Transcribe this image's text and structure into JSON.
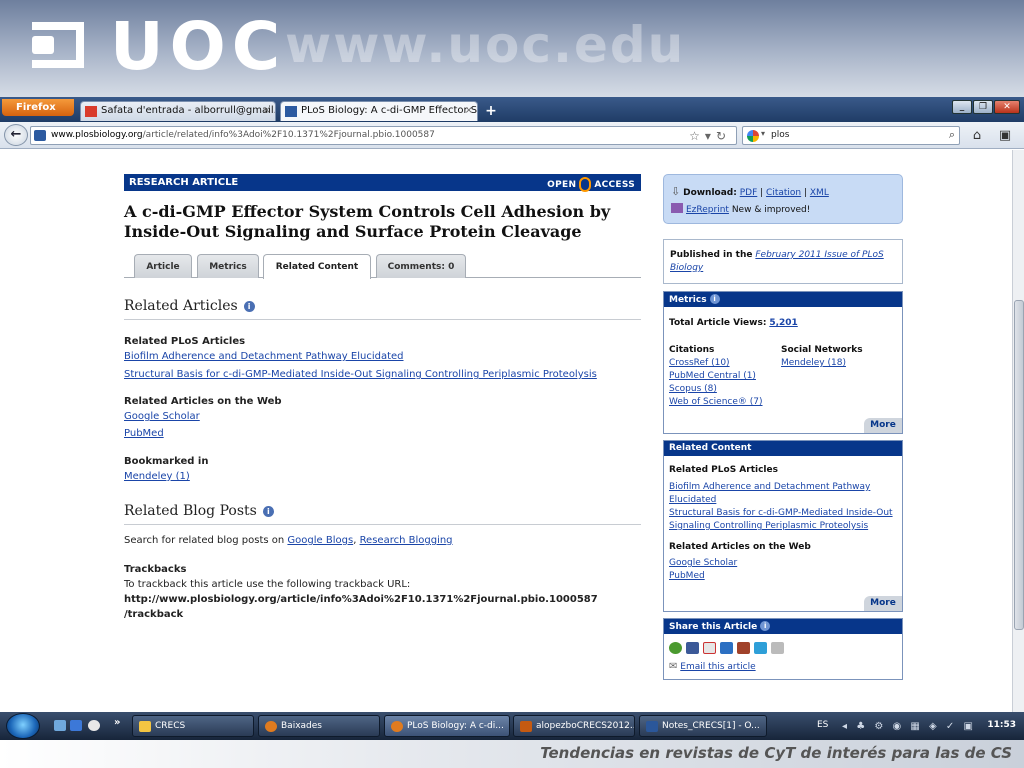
{
  "banner": {
    "logo_text": "UOC",
    "url_text": "www.uoc.edu"
  },
  "browser": {
    "menu_button": "Firefox",
    "tabs": [
      {
        "label": "Safata d'entrada - alborrull@gmail.co...",
        "active": false
      },
      {
        "label": "PLoS Biology: A c-di-GMP Effector Sy...",
        "active": true
      }
    ],
    "new_tab": "+",
    "url_host": "www.plosbiology.org",
    "url_path": "/article/related/info%3Adoi%2F10.1371%2Fjournal.pbio.1000587",
    "search_value": "plos"
  },
  "article": {
    "banner_label": "RESEARCH ARTICLE",
    "open_label": "OPEN",
    "access_label": "ACCESS",
    "title": "A c-di-GMP Effector System Controls Cell Adhesion by Inside-Out Signaling and Surface Protein Cleavage",
    "tabs": [
      "Article",
      "Metrics",
      "Related Content",
      "Comments: 0"
    ],
    "related_articles_heading": "Related Articles",
    "related_plos_heading": "Related PLoS Articles",
    "related_plos_links": [
      "Biofilm Adherence and Detachment Pathway Elucidated",
      "Structural Basis for c-di-GMP-Mediated Inside-Out Signaling Controlling Periplasmic Proteolysis"
    ],
    "related_web_heading": "Related Articles on the Web",
    "related_web_links": [
      "Google Scholar",
      "PubMed"
    ],
    "bookmarked_heading": "Bookmarked in",
    "bookmarked_links": [
      "Mendeley (1)"
    ],
    "blog_heading": "Related Blog Posts",
    "blog_text_prefix": "Search for related blog posts on",
    "blog_link1": "Google Blogs",
    "blog_sep": ",",
    "blog_link2": "Research Blogging",
    "trackbacks_heading": "Trackbacks",
    "trackbacks_text": "To trackback this article use the following trackback URL:",
    "trackback_url_line1": "http://www.plosbiology.org/article/info%3Adoi%2F10.1371%2Fjournal.pbio.1000587",
    "trackback_url_line2": "/trackback"
  },
  "sidebar": {
    "download_label": "Download:",
    "download_pdf": "PDF",
    "download_citation": "Citation",
    "download_xml": "XML",
    "ezreprint": "EzReprint",
    "ezreprint_note": "New & improved!",
    "published_prefix": "Published in the",
    "published_link": "February 2011 Issue of PLoS Biology",
    "metrics_heading": "Metrics",
    "total_views_label": "Total Article Views:",
    "total_views_value": "5,201",
    "citations_heading": "Citations",
    "citations_links": [
      "CrossRef (10)",
      "PubMed Central (1)",
      "Scopus (8)",
      "Web of Science® (7)"
    ],
    "social_heading": "Social Networks",
    "social_links": [
      "Mendeley (18)"
    ],
    "more_label": "More",
    "related_heading": "Related Content",
    "related_plos_heading": "Related PLoS Articles",
    "related_plos_links": [
      "Biofilm Adherence and Detachment Pathway Elucidated",
      "Structural Basis for c-di-GMP-Mediated Inside-Out Signaling Controlling Periplasmic Proteolysis"
    ],
    "related_web_heading": "Related Articles on the Web",
    "related_web_links": [
      "Google Scholar",
      "PubMed"
    ],
    "share_heading": "Share this Article",
    "email_link": "Email this article"
  },
  "taskbar": {
    "items": [
      {
        "label": "CRECS",
        "active": false
      },
      {
        "label": "Baixades",
        "active": false
      },
      {
        "label": "PLoS Biology: A c-di...",
        "active": true
      },
      {
        "label": "alopezboCRECS2012...",
        "active": false
      },
      {
        "label": "Notes_CRECS[1] - O...",
        "active": false
      }
    ],
    "lang": "ES",
    "clock": "11:53"
  },
  "footer": {
    "text": "Tendencias en revistas de CyT de interés para las de CS"
  },
  "colors": {
    "plos_navy": "#07368a",
    "link": "#1a45a8",
    "download_box": "#c8dbf5"
  }
}
